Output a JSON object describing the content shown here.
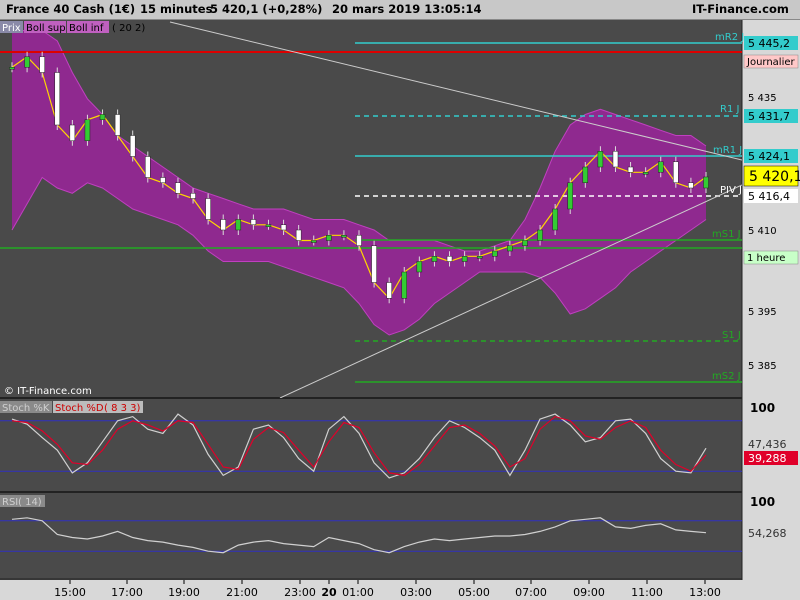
{
  "header": {
    "instrument": "France 40 Cash (1€)",
    "interval": "15 minutes",
    "last": "5 420,1 (+0,28%)",
    "datetime": "20 mars 2019 13:05:14",
    "brand": "IT-Finance.com"
  },
  "legend": {
    "prix": "Prix",
    "boll_sup": "Boll sup",
    "boll_inf": "Boll inf",
    "boll_params": "( 20 2)",
    "stoch_k": "Stoch %K",
    "stoch_d": "Stoch %D",
    "stoch_params": "( 8 3 3)",
    "rsi": "RSI",
    "rsi_params": "( 14)",
    "watermark": "© IT-Finance.com"
  },
  "colors": {
    "background": "#4a4a4a",
    "bollinger_fill": "#a020a0",
    "cloud_bull": "#22a022",
    "cloud_bear": "#4aa8c8",
    "candle_up": "#33cc33",
    "candle_down": "#ffffff",
    "price_badge": "#ffff00",
    "stoch_k": "#d0d0d0",
    "stoch_d": "#e0002a",
    "rsi": "#d0d0d0"
  },
  "price_axis": {
    "ticks": [
      "5 435",
      "5 410",
      "5 395",
      "5 385"
    ],
    "current": "5 420,1"
  },
  "levels": [
    {
      "name": "mR2 J",
      "value": "5 445,2",
      "color": "#33cccc",
      "style": "solid"
    },
    {
      "name": "Journalier",
      "value": "",
      "color": "#dd0000",
      "style": "solid"
    },
    {
      "name": "R1 J",
      "value": "5 431,7",
      "color": "#33cccc",
      "style": "dashed"
    },
    {
      "name": "mR1 J",
      "value": "5 424,1",
      "color": "#33cccc",
      "style": "solid"
    },
    {
      "name": "PIV J",
      "value": "5 416,4",
      "color": "#ffffff",
      "style": "dashed"
    },
    {
      "name": "mS1 J",
      "value": "",
      "color": "#22aa22",
      "style": "solid"
    },
    {
      "name": "1 heure",
      "value": "",
      "color": "#22aa22",
      "style": "solid"
    },
    {
      "name": "S1 J",
      "value": "",
      "color": "#22aa22",
      "style": "dashed"
    },
    {
      "name": "mS2 J",
      "value": "",
      "color": "#22aa22",
      "style": "solid"
    }
  ],
  "time_axis": {
    "ticks": [
      "15:00",
      "17:00",
      "19:00",
      "21:00",
      "23:00",
      "20",
      "01:00",
      "03:00",
      "05:00",
      "07:00",
      "09:00",
      "11:00",
      "13:00"
    ]
  },
  "stoch": {
    "top": "100",
    "k_value": "47,436",
    "d_value": "39,288"
  },
  "rsi": {
    "top": "100",
    "value": "54,268"
  },
  "chart_data": [
    {
      "type": "line",
      "title": "France 40 Cash (1€) 15 minutes",
      "x": [
        "14:00",
        "14:30",
        "15:00",
        "15:30",
        "16:00",
        "16:30",
        "17:00",
        "17:30",
        "18:00",
        "18:30",
        "19:00",
        "19:30",
        "20:00",
        "20:30",
        "21:00",
        "21:30",
        "22:00",
        "22:30",
        "23:00",
        "23:30",
        "00:00",
        "00:30",
        "01:00",
        "01:30",
        "02:00",
        "02:30",
        "03:00",
        "03:30",
        "04:00",
        "04:30",
        "05:00",
        "05:30",
        "06:00",
        "06:30",
        "07:00",
        "07:30",
        "08:00",
        "08:30",
        "09:00",
        "09:30",
        "10:00",
        "10:30",
        "11:00",
        "11:30",
        "12:00",
        "12:30",
        "13:00"
      ],
      "series": [
        {
          "name": "Prix",
          "values": [
            5441,
            5443,
            5440,
            5430,
            5427,
            5431,
            5432,
            5428,
            5424,
            5420,
            5419,
            5417,
            5416,
            5412,
            5410,
            5412,
            5411,
            5411,
            5410,
            5408,
            5408,
            5409,
            5409,
            5407,
            5400,
            5397,
            5402,
            5404,
            5405,
            5404,
            5405,
            5405,
            5406,
            5407,
            5408,
            5410,
            5414,
            5419,
            5422,
            5425,
            5422,
            5421,
            5421,
            5423,
            5419,
            5418,
            5420.1
          ]
        },
        {
          "name": "Boll sup",
          "values": [
            5448,
            5448,
            5448,
            5446,
            5440,
            5435,
            5432,
            5428,
            5426,
            5424,
            5422,
            5420,
            5418,
            5417,
            5416,
            5415,
            5414,
            5414,
            5414,
            5413,
            5412,
            5412,
            5412,
            5411,
            5410,
            5408,
            5408,
            5408,
            5408,
            5407,
            5406,
            5406,
            5407,
            5408,
            5412,
            5418,
            5425,
            5430,
            5432,
            5433,
            5432,
            5431,
            5430,
            5429,
            5428,
            5428,
            5426
          ]
        },
        {
          "name": "Boll inf",
          "values": [
            5410,
            5415,
            5420,
            5418,
            5417,
            5419,
            5418,
            5416,
            5414,
            5413,
            5412,
            5411,
            5409,
            5406,
            5404,
            5404,
            5404,
            5404,
            5403,
            5402,
            5401,
            5400,
            5399,
            5396,
            5392,
            5390,
            5391,
            5393,
            5396,
            5398,
            5400,
            5402,
            5402,
            5402,
            5402,
            5401,
            5398,
            5394,
            5395,
            5397,
            5399,
            5402,
            5404,
            5406,
            5408,
            5410,
            5412
          ]
        }
      ],
      "ylim": [
        5378,
        5450
      ]
    },
    {
      "type": "line",
      "title": "Stoch %K / Stoch %D ( 8 3 3)",
      "x": [
        "14:00",
        "14:30",
        "15:00",
        "15:30",
        "16:00",
        "16:30",
        "17:00",
        "17:30",
        "18:00",
        "18:30",
        "19:00",
        "19:30",
        "20:00",
        "20:30",
        "21:00",
        "21:30",
        "22:00",
        "22:30",
        "23:00",
        "23:30",
        "00:00",
        "00:30",
        "01:00",
        "01:30",
        "02:00",
        "02:30",
        "03:00",
        "03:30",
        "04:00",
        "04:30",
        "05:00",
        "05:30",
        "06:00",
        "06:30",
        "07:00",
        "07:30",
        "08:00",
        "08:30",
        "09:00",
        "09:30",
        "10:00",
        "10:30",
        "11:00",
        "11:30",
        "12:00",
        "12:30",
        "13:00"
      ],
      "series": [
        {
          "name": "Stoch %K",
          "values": [
            82,
            76,
            60,
            45,
            18,
            30,
            55,
            80,
            85,
            70,
            65,
            88,
            75,
            40,
            15,
            25,
            70,
            75,
            60,
            35,
            20,
            70,
            85,
            65,
            30,
            12,
            18,
            35,
            60,
            80,
            72,
            60,
            45,
            15,
            45,
            82,
            88,
            75,
            55,
            60,
            80,
            82,
            65,
            35,
            20,
            18,
            47.4
          ]
        },
        {
          "name": "Stoch %D",
          "values": [
            80,
            78,
            68,
            52,
            30,
            28,
            45,
            70,
            80,
            75,
            68,
            80,
            78,
            52,
            25,
            22,
            58,
            72,
            66,
            45,
            25,
            55,
            78,
            72,
            42,
            18,
            15,
            28,
            50,
            72,
            75,
            65,
            50,
            25,
            35,
            70,
            85,
            80,
            62,
            58,
            72,
            80,
            72,
            45,
            28,
            20,
            39.3
          ]
        }
      ],
      "ylim": [
        0,
        100
      ]
    },
    {
      "type": "line",
      "title": "RSI ( 14)",
      "x": [
        "14:00",
        "14:30",
        "15:00",
        "15:30",
        "16:00",
        "16:30",
        "17:00",
        "17:30",
        "18:00",
        "18:30",
        "19:00",
        "19:30",
        "20:00",
        "20:30",
        "21:00",
        "21:30",
        "22:00",
        "22:30",
        "23:00",
        "23:30",
        "00:00",
        "00:30",
        "01:00",
        "01:30",
        "02:00",
        "02:30",
        "03:00",
        "03:30",
        "04:00",
        "04:30",
        "05:00",
        "05:30",
        "06:00",
        "06:30",
        "07:00",
        "07:30",
        "08:00",
        "08:30",
        "09:00",
        "09:30",
        "10:00",
        "10:30",
        "11:00",
        "11:30",
        "12:00",
        "12:30",
        "13:00"
      ],
      "series": [
        {
          "name": "RSI",
          "values": [
            72,
            74,
            70,
            52,
            48,
            46,
            50,
            56,
            48,
            44,
            42,
            38,
            35,
            30,
            28,
            38,
            42,
            44,
            40,
            38,
            36,
            48,
            44,
            40,
            32,
            28,
            36,
            42,
            46,
            44,
            46,
            48,
            50,
            50,
            52,
            56,
            62,
            70,
            72,
            74,
            62,
            60,
            64,
            66,
            58,
            56,
            54.3
          ]
        }
      ],
      "ylim": [
        0,
        100
      ]
    }
  ]
}
